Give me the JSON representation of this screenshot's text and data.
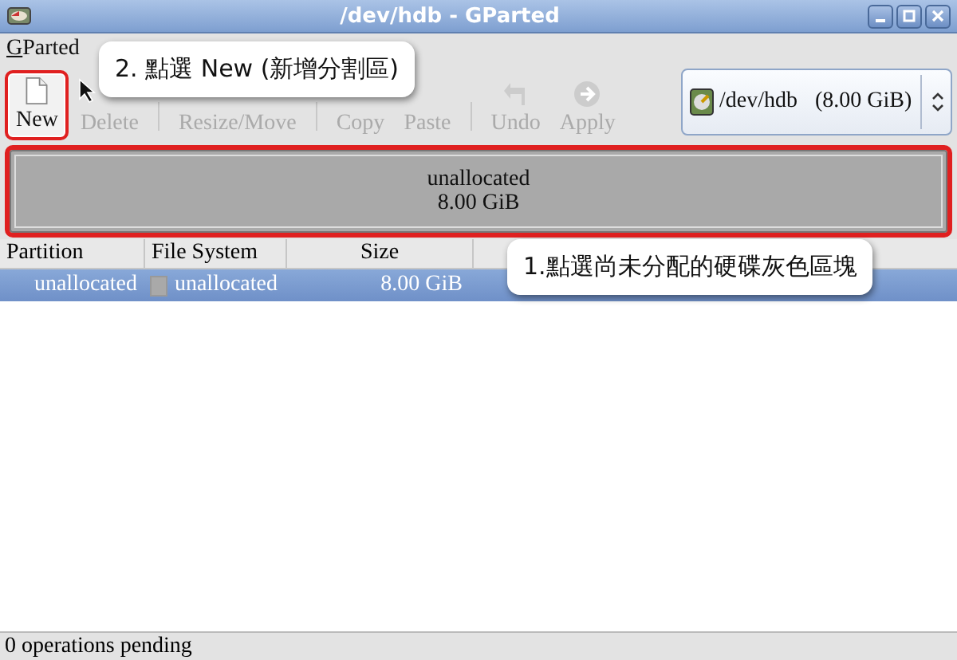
{
  "window": {
    "title": "/dev/hdb - GParted"
  },
  "menu": [
    {
      "label": "GParted"
    }
  ],
  "toolbar": [
    [
      {
        "label": "New",
        "kind": "page",
        "enabled": true,
        "highlighted": true
      },
      {
        "label": "Delete",
        "kind": "plain",
        "enabled": false,
        "highlighted": false
      }
    ],
    [
      {
        "label": "Resize/Move",
        "kind": "plain",
        "enabled": false,
        "highlighted": false
      }
    ],
    [
      {
        "label": "Copy",
        "kind": "plain",
        "enabled": false,
        "highlighted": false
      },
      {
        "label": "Paste",
        "kind": "plain",
        "enabled": false,
        "highlighted": false
      }
    ],
    [
      {
        "label": "Undo",
        "kind": "undo",
        "enabled": false,
        "highlighted": false
      },
      {
        "label": "Apply",
        "kind": "apply",
        "enabled": false,
        "highlighted": false
      }
    ]
  ],
  "device": {
    "name": "/dev/hdb",
    "size": "(8.00 GiB)"
  },
  "disk_map": {
    "label": "unallocated",
    "size": "8.00 GiB",
    "highlighted": true
  },
  "table": {
    "columns": [
      "Partition",
      "File System",
      "Size"
    ],
    "rows": [
      {
        "partition": "unallocated",
        "file_system": "unallocated",
        "size": "8.00 GiB",
        "selected": true
      }
    ]
  },
  "callouts": [
    {
      "text": "2. 點選 New (新增分割區)"
    },
    {
      "text": "1.點選尚未分配的硬碟灰色區塊"
    }
  ],
  "status_bar": "0 operations pending"
}
